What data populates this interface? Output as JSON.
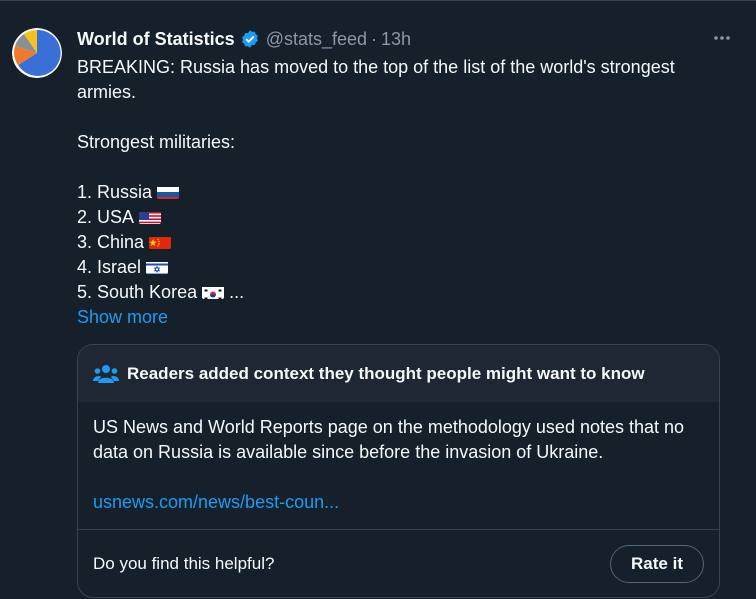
{
  "tweet": {
    "display_name": "World of Statistics",
    "handle": "@stats_feed",
    "separator": "·",
    "time": "13h",
    "text_lines": [
      "BREAKING: Russia has moved to the top of the list of the world's strongest",
      "armies.",
      "",
      "Strongest militaries:",
      ""
    ],
    "list": [
      {
        "label": "1. Russia",
        "flag": "russia-flag-icon"
      },
      {
        "label": "2. USA",
        "flag": "usa-flag-icon"
      },
      {
        "label": "3. China",
        "flag": "china-flag-icon"
      },
      {
        "label": "4. Israel",
        "flag": "israel-flag-icon"
      },
      {
        "label": "5. South Korea",
        "flag": "south-korea-flag-icon",
        "suffix": " ..."
      }
    ],
    "show_more": "Show more"
  },
  "community_note": {
    "title": "Readers added context they thought people might want to know",
    "body": "US News and World Reports page on the methodology used notes that no data on Russia is available since before the invasion of Ukraine.",
    "link": "usnews.com/news/best-coun...",
    "question": "Do you find this helpful?",
    "rate_button": "Rate it"
  },
  "colors": {
    "background": "#15202b",
    "accent": "#1d9bf0",
    "muted": "#8b98a5"
  }
}
